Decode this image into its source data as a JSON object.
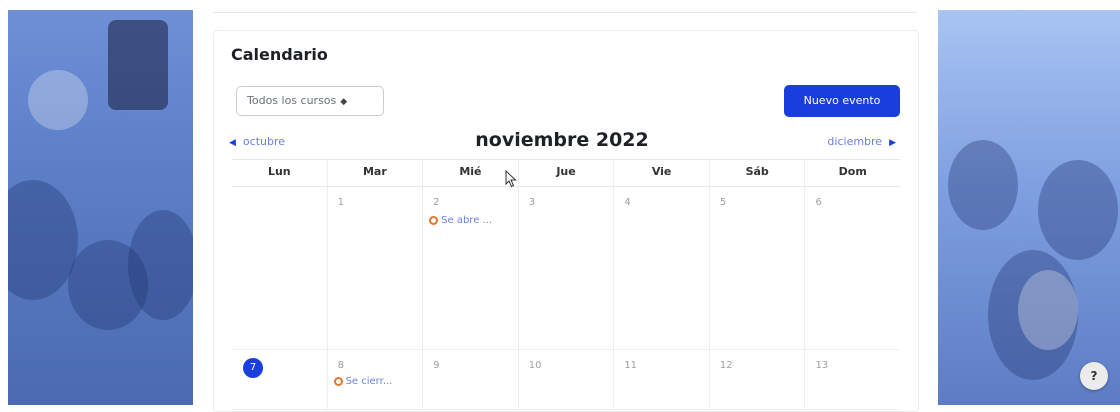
{
  "calendar": {
    "title": "Calendario",
    "course_filter": {
      "selected": "Todos los cursos"
    },
    "new_event_label": "Nuevo evento",
    "prev_month_label": "octubre",
    "next_month_label": "diciembre",
    "month_title": "noviembre 2022",
    "weekdays": [
      "Lun",
      "Mar",
      "Mié",
      "Jue",
      "Vie",
      "Sáb",
      "Dom"
    ],
    "week1": [
      {
        "day": ""
      },
      {
        "day": "1"
      },
      {
        "day": "2",
        "event": "Se abre ..."
      },
      {
        "day": "3"
      },
      {
        "day": "4"
      },
      {
        "day": "5"
      },
      {
        "day": "6"
      }
    ],
    "week2": [
      {
        "day": "7",
        "today": true
      },
      {
        "day": "8",
        "event": "Se cierr..."
      },
      {
        "day": "9"
      },
      {
        "day": "10"
      },
      {
        "day": "11"
      },
      {
        "day": "12"
      },
      {
        "day": "13"
      }
    ]
  },
  "help_label": "?",
  "colors": {
    "accent": "#1a3edc",
    "event_icon": "#e2762e",
    "link": "#6b7fdc"
  }
}
